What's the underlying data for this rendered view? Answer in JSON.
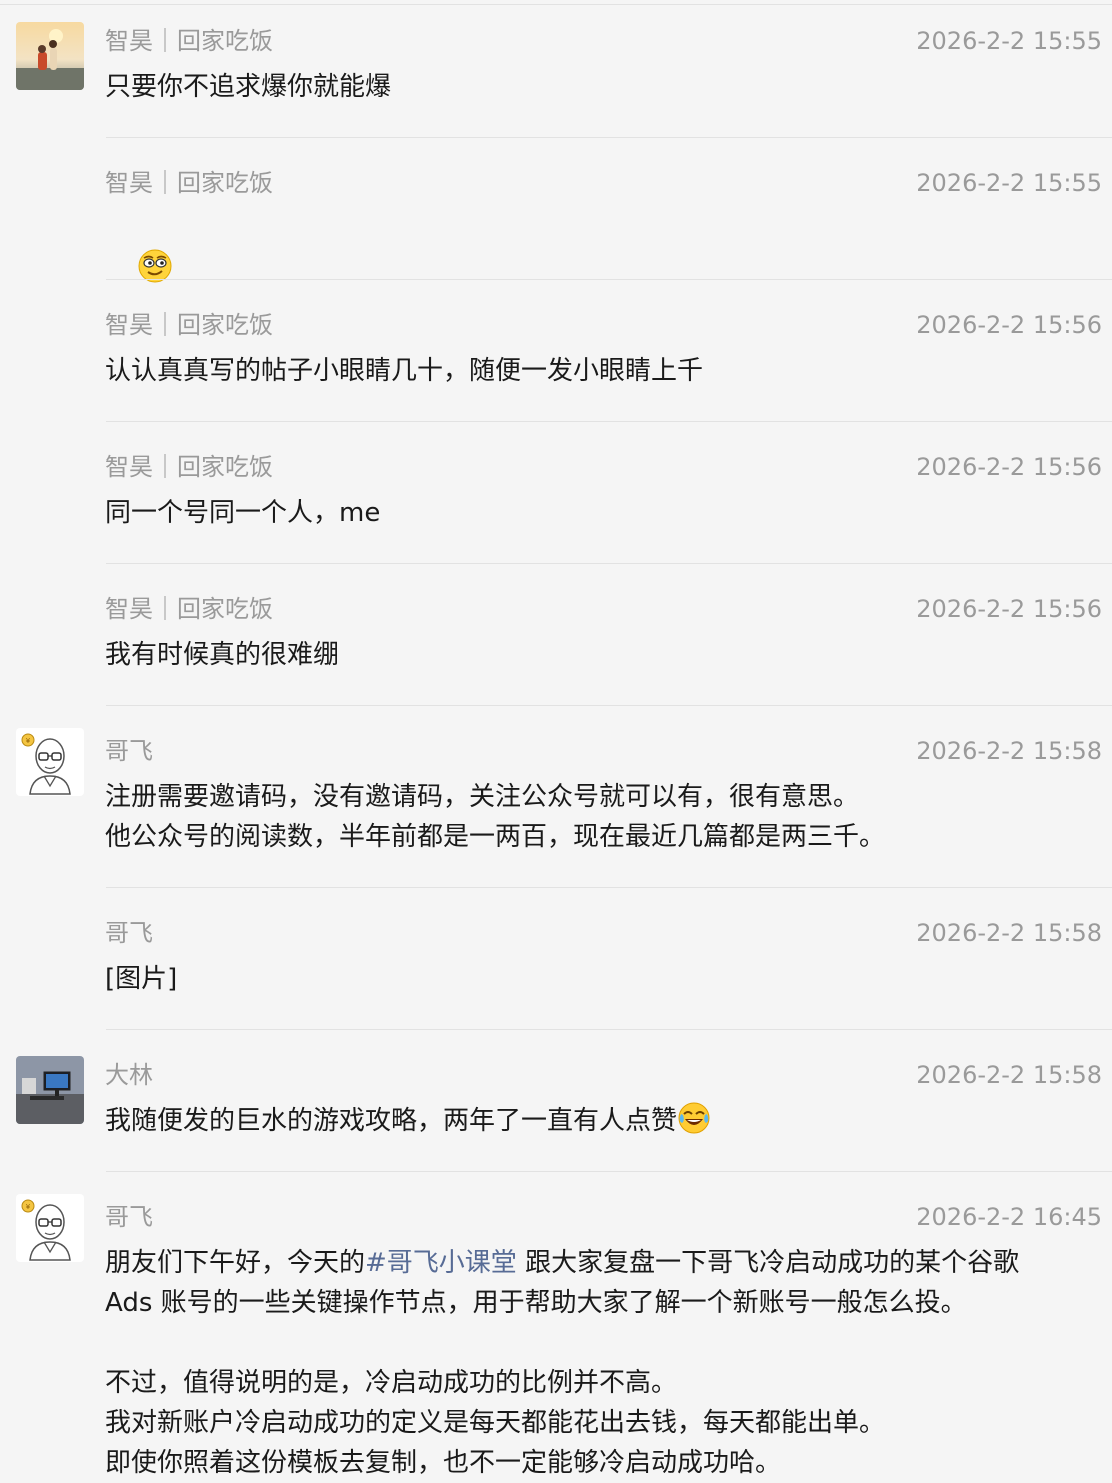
{
  "messages": [
    {
      "name": "智昊｜回家吃饭",
      "time": "2026-2-2 15:55",
      "text": "只要你不追求爆你就能爆",
      "avatar": "photo-sunset-couple"
    },
    {
      "name": "智昊｜回家吃饭",
      "time": "2026-2-2 15:55",
      "text": "",
      "emoji": "smirk-face-icon"
    },
    {
      "name": "智昊｜回家吃饭",
      "time": "2026-2-2 15:56",
      "text": "认认真真写的帖子小眼睛几十，随便一发小眼睛上千"
    },
    {
      "name": "智昊｜回家吃饭",
      "time": "2026-2-2 15:56",
      "text": "同一个号同一个人，me"
    },
    {
      "name": "智昊｜回家吃饭",
      "time": "2026-2-2 15:56",
      "text": "我有时候真的很难绷"
    },
    {
      "name": "哥飞",
      "time": "2026-2-2 15:58",
      "text": "注册需要邀请码，没有邀请码，关注公众号就可以有，很有意思。\n他公众号的阅读数，半年前都是一两百，现在最近几篇都是两三千。",
      "avatar": "cartoon-bald-glasses-man"
    },
    {
      "name": "哥飞",
      "time": "2026-2-2 15:58",
      "text": "[图片]"
    },
    {
      "name": "大林",
      "time": "2026-2-2 15:58",
      "text": "我随便发的巨水的游戏攻略，两年了一直有人点赞",
      "emoji": "tears-of-joy-icon",
      "avatar": "photo-desk-monitor"
    },
    {
      "name": "哥飞",
      "time": "2026-2-2 16:45",
      "avatar": "cartoon-bald-glasses-man",
      "text_a": "朋友们下午好，今天的",
      "hashtag": "#哥飞小课堂",
      "text_b": " 跟大家复盘一下哥飞冷启动成功的某个谷歌\nAds 账号的一些关键操作节点，用于帮助大家了解一个新账号一般怎么投。\n\n不过，值得说明的是，冷启动成功的比例并不高。\n我对新账户冷启动成功的定义是每天都能花出去钱，每天都能出单。\n即使你照着这份模板去复制，也不一定能够冷启动成功哈。"
    }
  ],
  "colors": {
    "background": "#f5f5f5",
    "meta": "#9a9a9a",
    "hashtag": "#576b95",
    "divider": "#e2e2e2"
  }
}
